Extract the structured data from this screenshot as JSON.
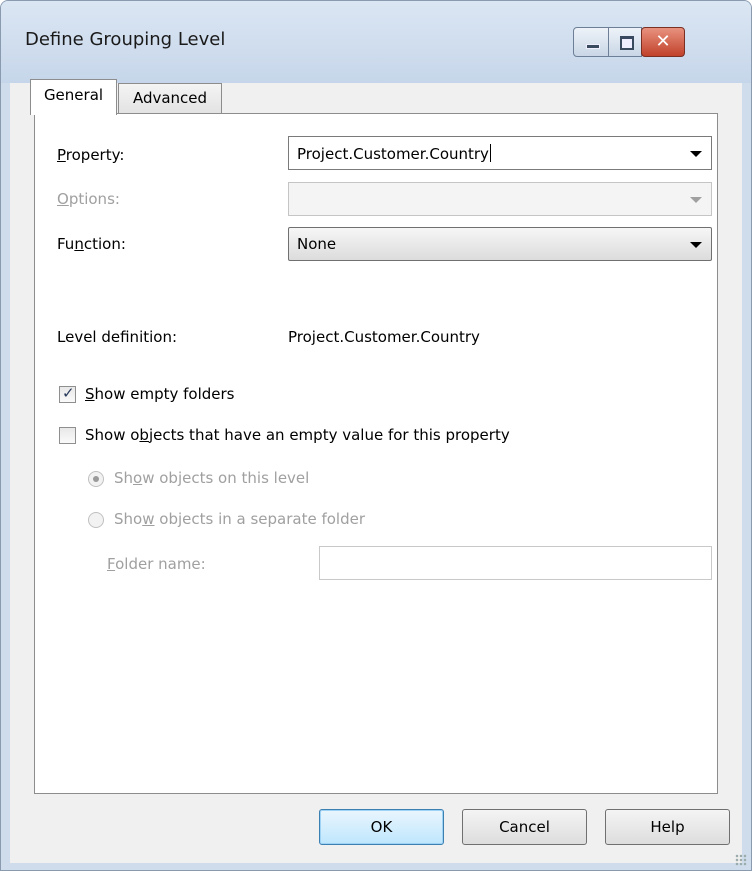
{
  "window": {
    "title": "Define Grouping Level"
  },
  "tabs": [
    {
      "label": "General",
      "active": true
    },
    {
      "label": "Advanced",
      "active": false
    }
  ],
  "fields": {
    "property": {
      "label_pre": "",
      "label_key": "P",
      "label_post": "roperty:",
      "value": "Project.Customer.Country"
    },
    "options": {
      "label_pre": "",
      "label_key": "O",
      "label_post": "ptions:",
      "value": "",
      "enabled": false
    },
    "function": {
      "label_pre": "Fu",
      "label_key": "n",
      "label_post": "ction:",
      "value": "None"
    },
    "level_definition": {
      "label": "Level definition:",
      "value": "Project.Customer.Country"
    }
  },
  "checkboxes": {
    "show_empty": {
      "label_pre": "",
      "label_key": "S",
      "label_post": "how empty folders",
      "checked": true
    },
    "show_objects": {
      "label_pre": "Show o",
      "label_key": "b",
      "label_post": "jects that have an empty value for this property",
      "checked": false
    }
  },
  "radios": {
    "on_level": {
      "label_pre": "Sh",
      "label_key": "o",
      "label_post": "w objects on this level",
      "selected": true,
      "enabled": false
    },
    "separate": {
      "label_pre": "Sho",
      "label_key": "w",
      "label_post": " objects in a separate folder",
      "selected": false,
      "enabled": false
    }
  },
  "folder_name": {
    "label_pre": "",
    "label_key": "F",
    "label_post": "older name:",
    "value": ""
  },
  "buttons": {
    "ok": "OK",
    "cancel": "Cancel",
    "help": "Help"
  },
  "colors": {
    "accent": "#3c7fb1",
    "close": "#c1412a",
    "disabled_text": "#a0a0a0"
  }
}
